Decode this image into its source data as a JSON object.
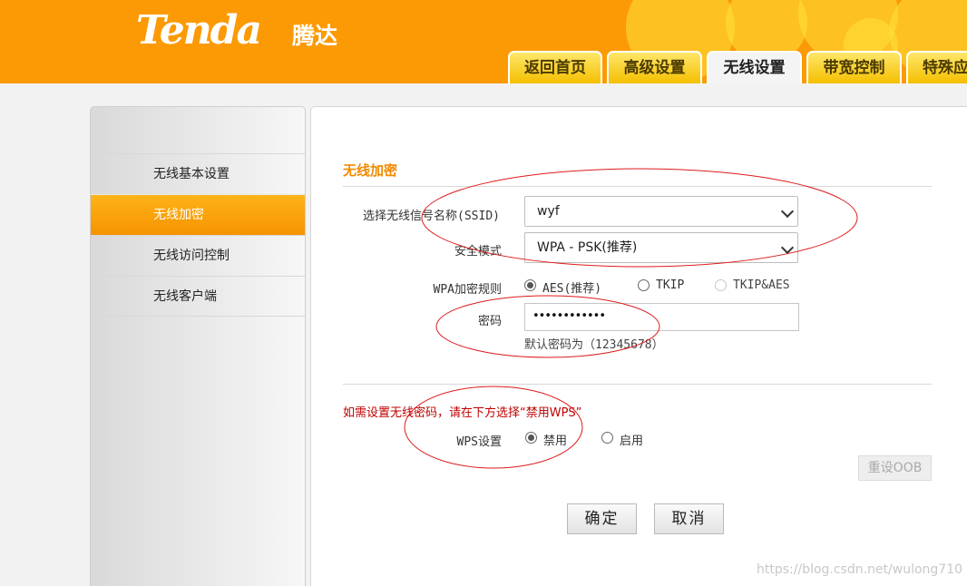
{
  "brand": {
    "logo_text": "Tenda",
    "logo_cn": "腾达"
  },
  "nav_tabs": [
    {
      "label": "返回首页",
      "active": false
    },
    {
      "label": "高级设置",
      "active": false
    },
    {
      "label": "无线设置",
      "active": true
    },
    {
      "label": "带宽控制",
      "active": false
    },
    {
      "label": "特殊应",
      "active": false
    }
  ],
  "sidebar": {
    "items": [
      {
        "label": "无线基本设置",
        "active": false
      },
      {
        "label": "无线加密",
        "active": true
      },
      {
        "label": "无线访问控制",
        "active": false
      },
      {
        "label": "无线客户端",
        "active": false
      }
    ]
  },
  "form": {
    "section_title": "无线加密",
    "ssid_label": "选择无线信号名称(SSID)",
    "ssid_value": "wyf",
    "security_label": "安全模式",
    "security_value": "WPA - PSK(推荐)",
    "cipher_label": "WPA加密规则",
    "cipher_options": [
      "AES(推荐)",
      "TKIP",
      "TKIP&AES"
    ],
    "cipher_selected": "AES(推荐)",
    "password_label": "密码",
    "password_mask": "••••••••••••",
    "password_hint": "默认密码为（12345678）",
    "wps_warning": "如需设置无线密码，请在下方选择“禁用WPS”",
    "wps_label": "WPS设置",
    "wps_options": [
      "禁用",
      "启用"
    ],
    "wps_selected": "禁用",
    "reset_oob_label": "重设OOB",
    "ok_label": "确定",
    "cancel_label": "取消"
  },
  "colors": {
    "brand_orange": "#fb9a04",
    "accent_text": "#f28a00",
    "warning_red": "#c00000",
    "annotation_red": "#dd1a1a"
  },
  "watermark": "https://blog.csdn.net/wulong710"
}
